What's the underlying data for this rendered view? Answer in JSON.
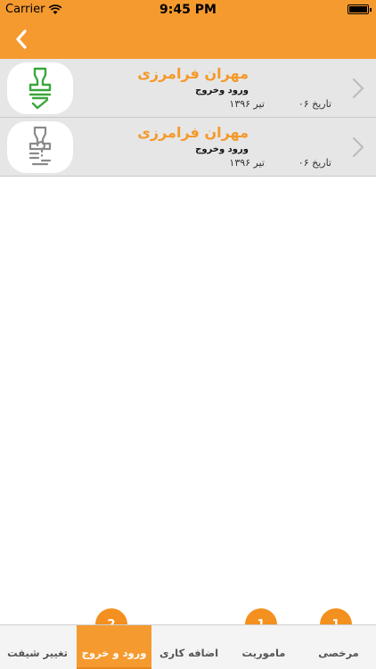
{
  "status_bar": {
    "carrier": "Carrier",
    "time": "9:45 PM"
  },
  "navbar": {
    "back_icon": "chevron-left-icon"
  },
  "records": [
    {
      "name": "مهران فرامرزی",
      "type": "ورود وخروج",
      "date_label": "تاریخ ۰۶",
      "month": "تیر ۱۳۹۶",
      "icon": "stamp-check-icon",
      "icon_color": "#3aa63a"
    },
    {
      "name": "مهران فرامرزی",
      "type": "ورود وخروج",
      "date_label": "تاریخ ۰۶",
      "month": "تیر ۱۳۹۶",
      "icon": "stamp-question-icon",
      "icon_color": "#8a8a8a"
    }
  ],
  "tabs": [
    {
      "label": "مرخصی",
      "badge": "1"
    },
    {
      "label": "ماموریت",
      "badge": "1"
    },
    {
      "label": "اضافه کاری",
      "badge": ""
    },
    {
      "label": "ورود و خروج",
      "badge": "2",
      "active": true
    },
    {
      "label": "تغییر شیفت",
      "badge": ""
    }
  ],
  "colors": {
    "accent": "#f59a2f",
    "badge": "#f4901f",
    "name_text": "#f5992a",
    "row_background": "#e6e6e6"
  }
}
